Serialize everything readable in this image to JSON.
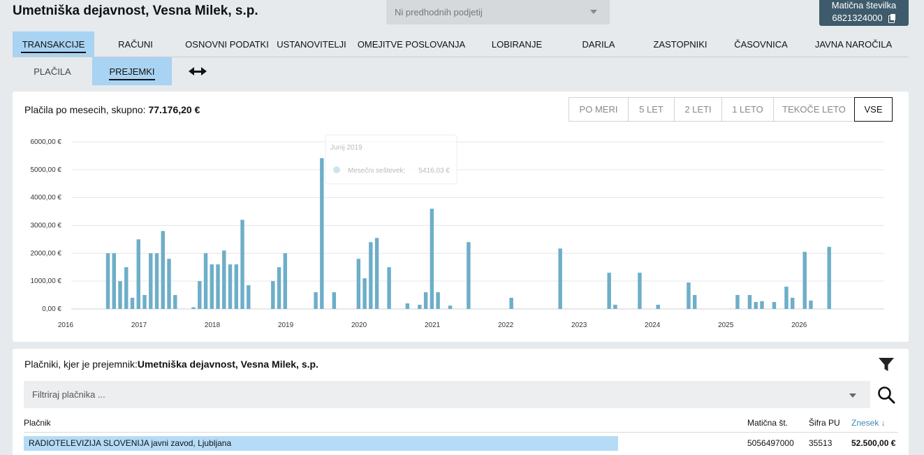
{
  "header": {
    "title": "Umetniška dejavnost, Vesna Milek, s.p.",
    "prev_placeholder": "Ni predhodnih podjetij",
    "maticna_label": "Matična številka",
    "maticna_number": "6821324000"
  },
  "tabs": [
    {
      "label": "Transakcije",
      "active": true
    },
    {
      "label": "Računi"
    },
    {
      "label": "Osnovni podatki"
    },
    {
      "label": "Ustanovitelji"
    },
    {
      "label": "Omejitve poslovanja"
    },
    {
      "label": "Lobiranje"
    },
    {
      "label": "Darila"
    },
    {
      "label": "Zastopniki"
    },
    {
      "label": "Časovnica"
    },
    {
      "label": "Javna naročila"
    }
  ],
  "subtabs": [
    {
      "label": "Plačila"
    },
    {
      "label": "Prejemki",
      "active": true
    }
  ],
  "chart_section": {
    "title_prefix": "Plačila po mesecih, skupno:",
    "total": "77.176,20 €",
    "ranges": [
      "Po meri",
      "5 let",
      "2 leti",
      "1 leto",
      "Tekoče leto",
      "VSE"
    ],
    "active_range": "VSE"
  },
  "tooltip": {
    "title": "Junij 2019",
    "series_label": "Mesečni seštevek:",
    "value": "5416,03 €"
  },
  "chart_data": {
    "type": "bar",
    "x_unit": "month",
    "xlim": [
      "2016-01",
      "2027-02"
    ],
    "ylim": [
      0,
      6000
    ],
    "yticks": [
      "0,00 €",
      "1000,00 €",
      "2000,00 €",
      "3000,00 €",
      "4000,00 €",
      "5000,00 €",
      "6000,00 €"
    ],
    "xticks": [
      "2016",
      "2017",
      "2018",
      "2019",
      "2020",
      "2021",
      "2022",
      "2023",
      "2024",
      "2025",
      "2026"
    ],
    "grid": true,
    "color": "#6daec8",
    "x": [
      "2016-07",
      "2016-08",
      "2016-09",
      "2016-10",
      "2016-11",
      "2016-12",
      "2017-01",
      "2017-02",
      "2017-03",
      "2017-04",
      "2017-05",
      "2017-06",
      "2017-09",
      "2017-10",
      "2017-11",
      "2017-12",
      "2018-01",
      "2018-02",
      "2018-03",
      "2018-04",
      "2018-05",
      "2018-06",
      "2018-10",
      "2018-11",
      "2018-12",
      "2019-05",
      "2019-06",
      "2019-08",
      "2019-12",
      "2020-01",
      "2020-02",
      "2020-03",
      "2020-05",
      "2020-08",
      "2020-10",
      "2020-11",
      "2020-12",
      "2021-01",
      "2021-03",
      "2021-06",
      "2022-01",
      "2022-09",
      "2023-05",
      "2023-06",
      "2023-10",
      "2024-01",
      "2024-06",
      "2024-07",
      "2025-02",
      "2025-04",
      "2025-05",
      "2025-06",
      "2025-08",
      "2025-10",
      "2025-11",
      "2026-01",
      "2026-02",
      "2026-05"
    ],
    "values": [
      2000,
      2000,
      1000,
      1500,
      400,
      2500,
      500,
      2000,
      2000,
      2800,
      1800,
      500,
      60,
      1000,
      2000,
      1600,
      1600,
      2100,
      1600,
      1600,
      3200,
      850,
      1000,
      1500,
      2000,
      600,
      5416.03,
      600,
      1800,
      1100,
      2400,
      2550,
      1500,
      200,
      150,
      600,
      3600,
      600,
      120,
      2400,
      400,
      2170,
      1300,
      150,
      1300,
      150,
      950,
      500,
      500,
      500,
      250,
      280,
      250,
      800,
      400,
      2050,
      300,
      2230
    ]
  },
  "payers": {
    "title_prefix": "Plačniki, kjer je prejemnik:",
    "title_entity": "Umetniška dejavnost, Vesna Milek, s.p.",
    "filter_placeholder": "Filtriraj plačnika ...",
    "columns": {
      "name": "Plačnik",
      "maticna": "Matična št.",
      "sifra": "Šifra PU",
      "amount": "Znesek ↓"
    },
    "rows": [
      {
        "name": "RADIOTELEVIZIJA SLOVENIJA javni zavod, Ljubljana",
        "maticna": "5056497000",
        "sifra": "35513",
        "amount": "52.500,00 €"
      }
    ]
  }
}
